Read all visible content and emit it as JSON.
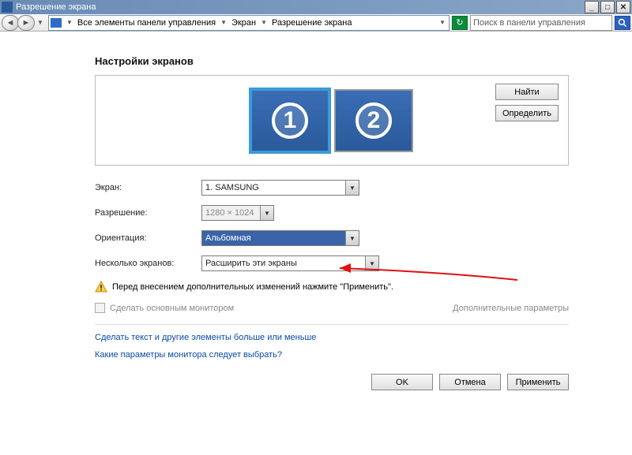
{
  "window": {
    "title": "Разрешение экрана",
    "breadcrumb": {
      "root": "Все элементы панели управления",
      "mid": "Экран",
      "leaf": "Разрешение экрана"
    },
    "search_placeholder": "Поиск в панели управления"
  },
  "page": {
    "title": "Настройки экранов",
    "monitor1": "1",
    "monitor2": "2",
    "find_btn": "Найти",
    "detect_btn": "Определить"
  },
  "form": {
    "screen_label": "Экран:",
    "screen_value": "1. SAMSUNG",
    "resolution_label": "Разрешение:",
    "resolution_value": "1280 × 1024",
    "orientation_label": "Ориентация:",
    "orientation_value": "Альбомная",
    "multi_label": "Несколько экранов:",
    "multi_value": "Расширить эти экраны"
  },
  "warning": "Перед внесением дополнительных изменений нажмите \"Применить\".",
  "checkbox_label": "Сделать основным монитором",
  "advanced_link": "Дополнительные параметры",
  "link1": "Сделать текст и другие элементы больше или меньше",
  "link2": "Какие параметры монитора следует выбрать?",
  "actions": {
    "ok": "OK",
    "cancel": "Отмена",
    "apply": "Применить"
  }
}
